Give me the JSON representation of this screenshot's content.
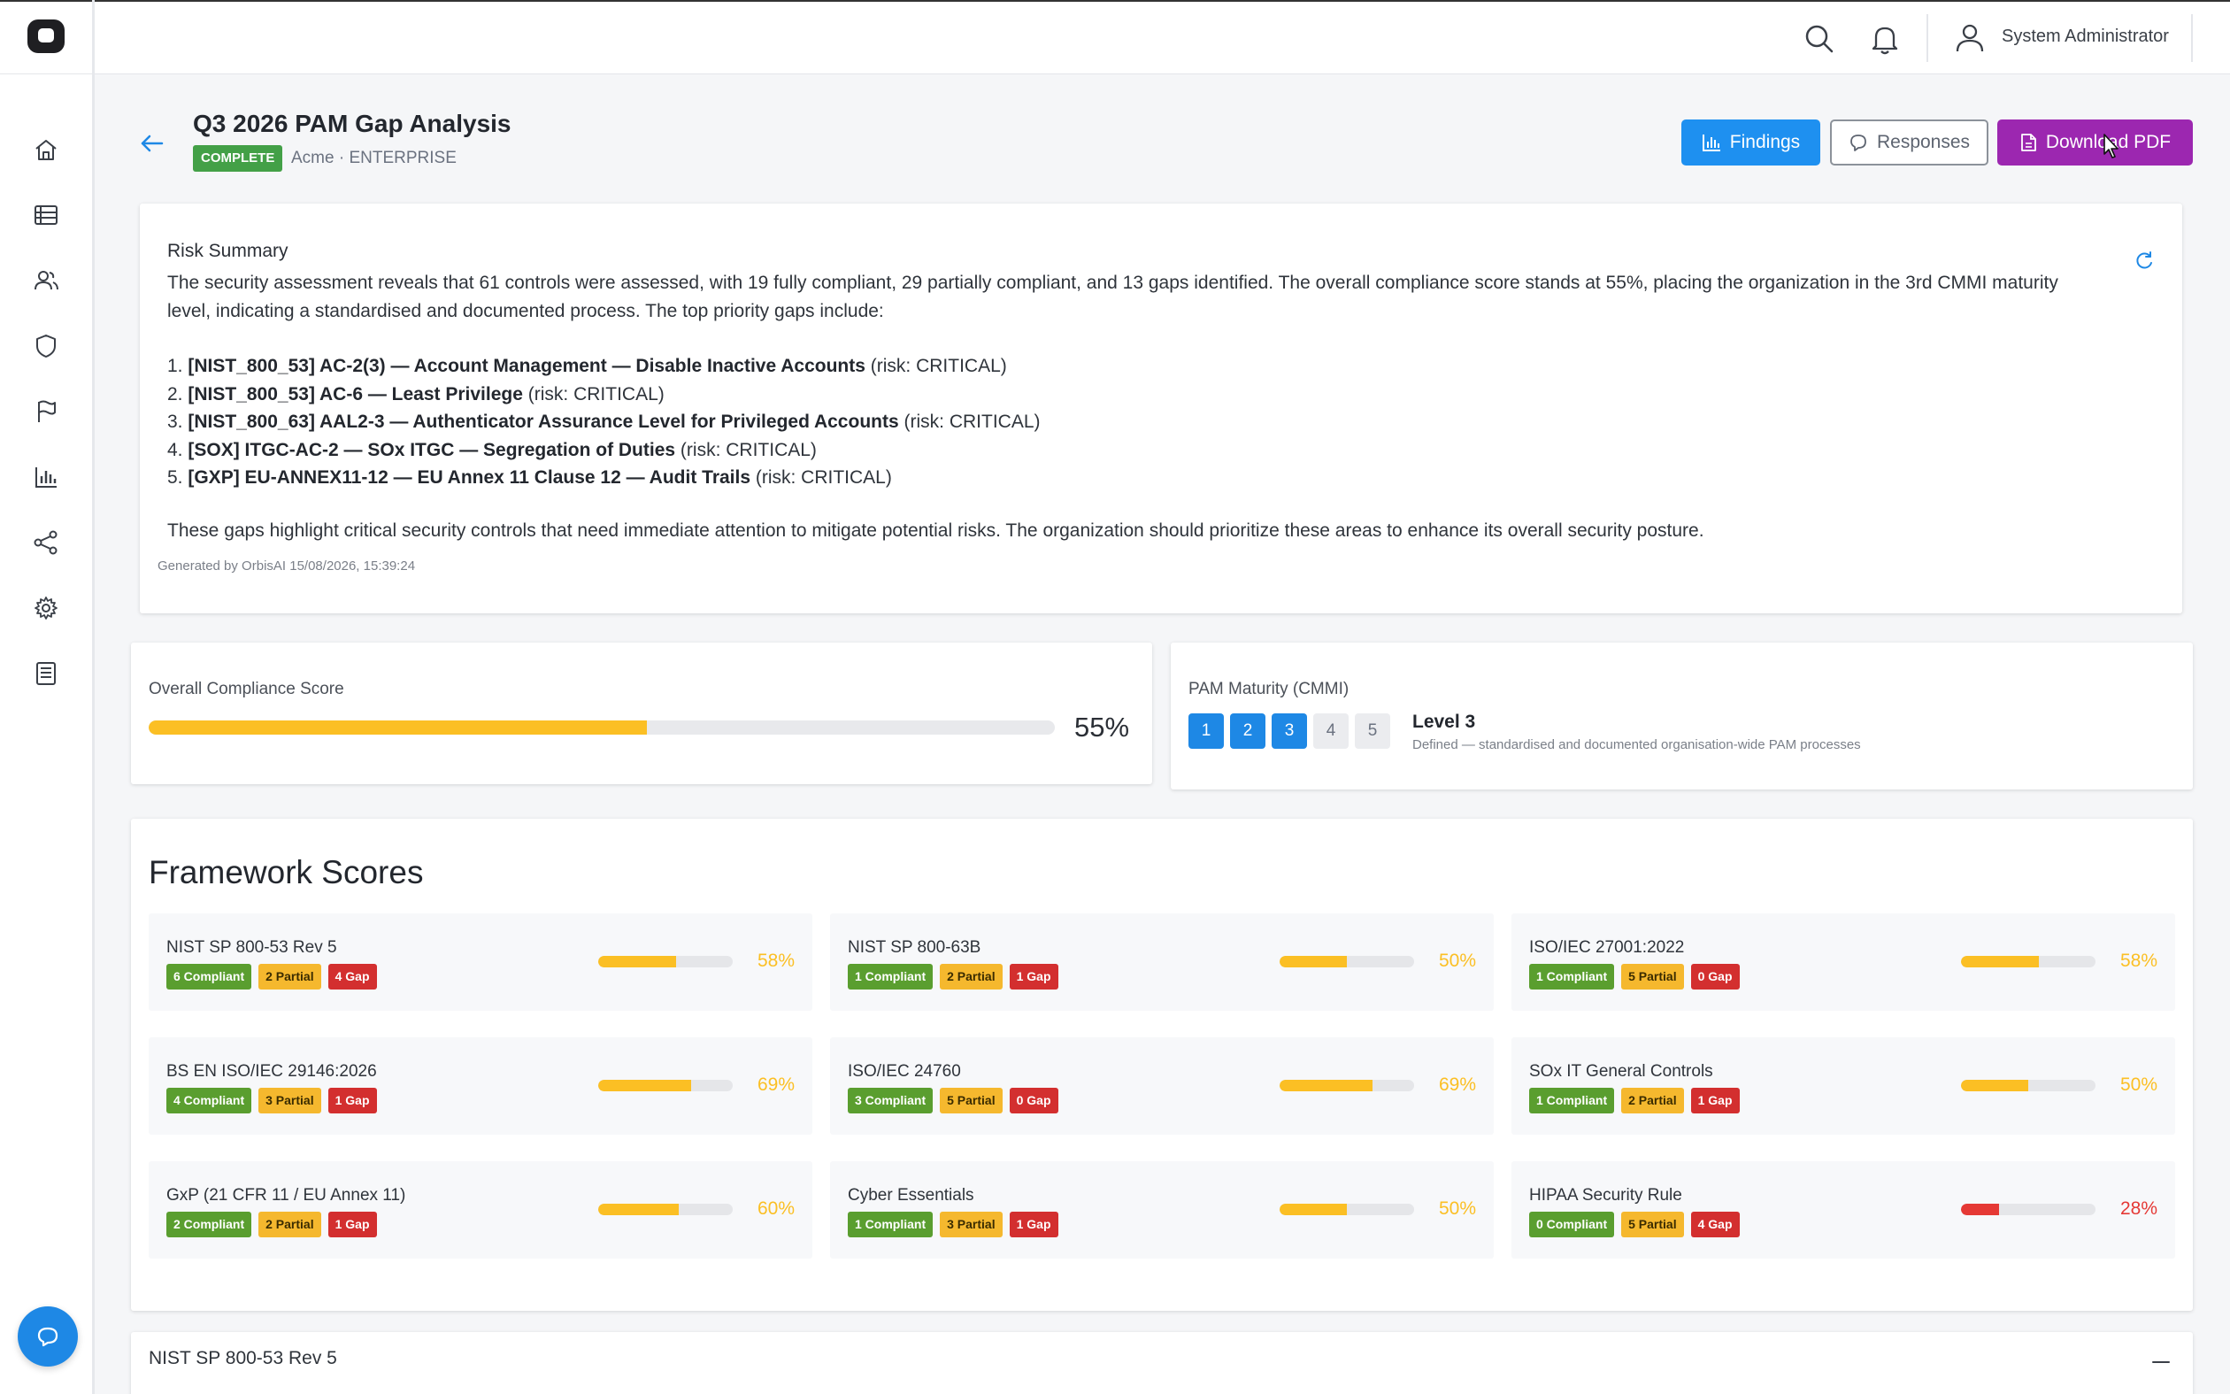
{
  "header": {
    "user_name": "System Administrator",
    "icons": [
      "search-icon",
      "bell-icon",
      "user-icon"
    ]
  },
  "sidebar": {
    "items": [
      {
        "icon": "home-icon"
      },
      {
        "icon": "list-icon"
      },
      {
        "icon": "users-icon"
      },
      {
        "icon": "shield-icon"
      },
      {
        "icon": "flag-icon"
      },
      {
        "icon": "bar-chart-icon"
      },
      {
        "icon": "share-icon"
      },
      {
        "icon": "gear-icon"
      },
      {
        "icon": "document-icon"
      }
    ],
    "chat_icon": "chat-icon"
  },
  "page": {
    "title": "Q3 2026 PAM Gap Analysis",
    "status": "COMPLETE",
    "subtitle": "Acme · ENTERPRISE",
    "buttons": {
      "findings": "Findings",
      "responses": "Responses",
      "download": "Download PDF"
    }
  },
  "risk_summary": {
    "title": "Risk Summary",
    "intro": "The security assessment reveals that 61 controls were assessed, with 19 fully compliant, 29 partially compliant, and 13 gaps identified. The overall compliance score stands at 55%, placing the organization in the 3rd CMMI maturity level, indicating a standardised and documented process. The top priority gaps include:",
    "gaps": [
      {
        "num": "1.",
        "id": "[NIST_800_53] AC-2(3)",
        "name": "Account Management — Disable Inactive Accounts",
        "risk": "(risk: CRITICAL)"
      },
      {
        "num": "2.",
        "id": "[NIST_800_53] AC-6",
        "name": "Least Privilege",
        "risk": "(risk: CRITICAL)"
      },
      {
        "num": "3.",
        "id": "[NIST_800_63] AAL2-3",
        "name": "Authenticator Assurance Level for Privileged Accounts",
        "risk": "(risk: CRITICAL)"
      },
      {
        "num": "4.",
        "id": "[SOX] ITGC-AC-2",
        "name": "SOx ITGC — Segregation of Duties",
        "risk": "(risk: CRITICAL)"
      },
      {
        "num": "5.",
        "id": "[GXP] EU-ANNEX11-12",
        "name": "EU Annex 11 Clause 12 — Audit Trails",
        "risk": "(risk: CRITICAL)"
      }
    ],
    "separator": " — ",
    "conclusion": "These gaps highlight critical security controls that need immediate attention to mitigate potential risks. The organization should prioritize these areas to enhance its overall security posture.",
    "generated": "Generated by OrbisAI 15/08/2026, 15:39:24"
  },
  "compliance": {
    "label": "Overall Compliance Score",
    "value": "55%",
    "fraction": 0.55,
    "bar_color": "#fbbf24"
  },
  "maturity": {
    "label": "PAM Maturity (CMMI)",
    "levels": [
      "1",
      "2",
      "3",
      "4",
      "5"
    ],
    "current": 3,
    "level_title": "Level 3",
    "level_desc": "Defined — standardised and documented organisation-wide PAM processes"
  },
  "frameworks": {
    "heading": "Framework Scores",
    "items": [
      {
        "name": "NIST SP 800-53 Rev 5",
        "compliant": "6 Compliant",
        "partial": "2 Partial",
        "gap": "4 Gap",
        "pct": "58%",
        "fraction": 0.58,
        "color": "#fbbf24"
      },
      {
        "name": "NIST SP 800-63B",
        "compliant": "1 Compliant",
        "partial": "2 Partial",
        "gap": "1 Gap",
        "pct": "50%",
        "fraction": 0.5,
        "color": "#fbbf24"
      },
      {
        "name": "ISO/IEC 27001:2022",
        "compliant": "1 Compliant",
        "partial": "5 Partial",
        "gap": "0 Gap",
        "pct": "58%",
        "fraction": 0.58,
        "color": "#fbbf24"
      },
      {
        "name": "BS EN ISO/IEC 29146:2026",
        "compliant": "4 Compliant",
        "partial": "3 Partial",
        "gap": "1 Gap",
        "pct": "69%",
        "fraction": 0.69,
        "color": "#fbbf24"
      },
      {
        "name": "ISO/IEC 24760",
        "compliant": "3 Compliant",
        "partial": "5 Partial",
        "gap": "0 Gap",
        "pct": "69%",
        "fraction": 0.69,
        "color": "#fbbf24"
      },
      {
        "name": "SOx IT General Controls",
        "compliant": "1 Compliant",
        "partial": "2 Partial",
        "gap": "1 Gap",
        "pct": "50%",
        "fraction": 0.5,
        "color": "#fbbf24"
      },
      {
        "name": "GxP (21 CFR 11 / EU Annex 11)",
        "compliant": "2 Compliant",
        "partial": "2 Partial",
        "gap": "1 Gap",
        "pct": "60%",
        "fraction": 0.6,
        "color": "#fbbf24"
      },
      {
        "name": "Cyber Essentials",
        "compliant": "1 Compliant",
        "partial": "3 Partial",
        "gap": "1 Gap",
        "pct": "50%",
        "fraction": 0.5,
        "color": "#fbbf24"
      },
      {
        "name": "HIPAA Security Rule",
        "compliant": "0 Compliant",
        "partial": "5 Partial",
        "gap": "4 Gap",
        "pct": "28%",
        "fraction": 0.28,
        "color": "#e53935"
      }
    ]
  },
  "section": {
    "title": "NIST SP 800-53 Rev 5"
  }
}
